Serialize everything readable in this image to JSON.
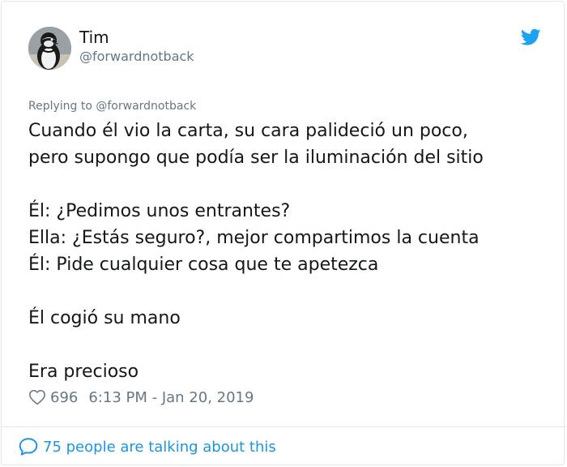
{
  "author": {
    "display_name": "Tim",
    "handle": "@forwardnotback",
    "avatar_icon": "penguin-avatar"
  },
  "reply_context": "Replying to @forwardnotback",
  "tweet": {
    "lines": [
      "Cuando él vio la carta, su cara palideció un poco,",
      "pero supongo que podía ser la iluminación del sitio",
      "",
      "Él: ¿Pedimos unos entrantes?",
      "Ella: ¿Estás seguro?, mejor compartimos la cuenta",
      "Él: Pide cualquier cosa que te apetezca",
      "",
      "Él cogió su mano",
      "",
      "Era precioso"
    ]
  },
  "meta": {
    "likes": "696",
    "timestamp": "6:13 PM - Jan 20, 2019"
  },
  "footer": {
    "talking_text": "75 people are talking about this"
  },
  "icons": {
    "brand": "twitter-bird-icon",
    "like": "heart-icon",
    "conversation": "speech-bubble-icon"
  },
  "colors": {
    "accent": "#1da1f2",
    "link": "#1b95e0",
    "muted": "#657786",
    "text": "#14171a",
    "border": "#e1e8ed"
  }
}
